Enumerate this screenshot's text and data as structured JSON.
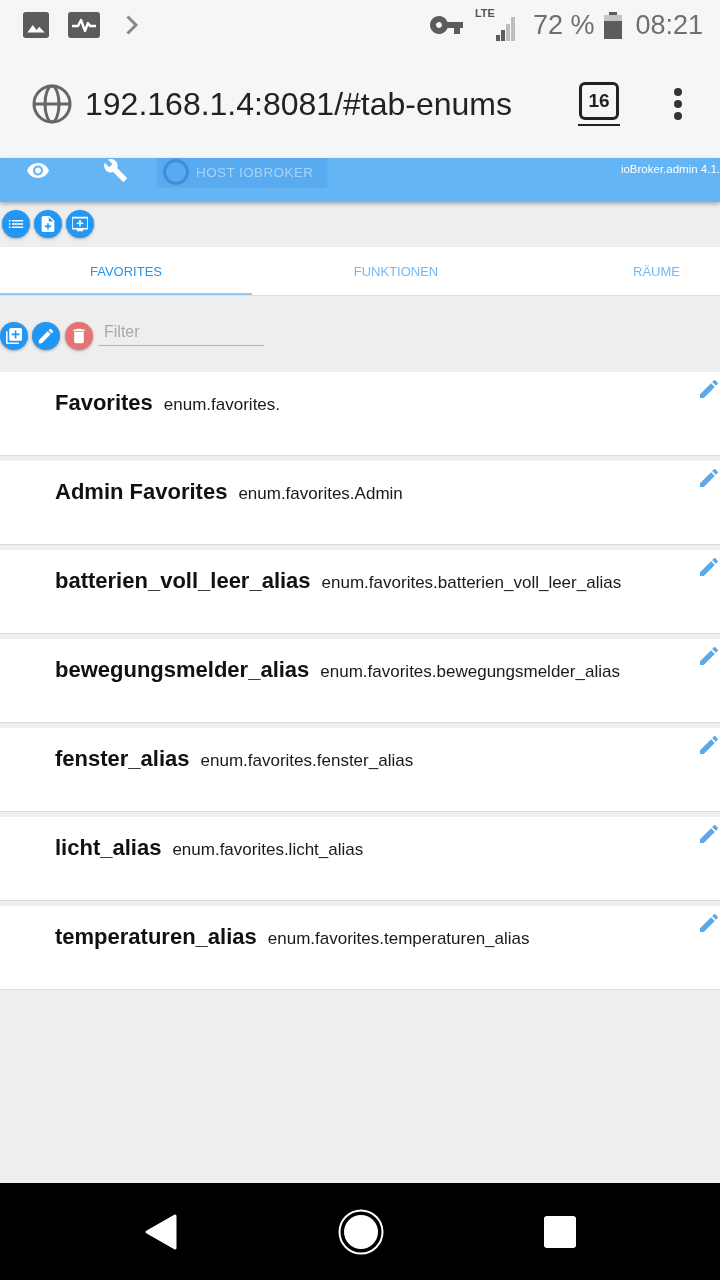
{
  "status_bar": {
    "network": "LTE",
    "battery": "72 %",
    "time": "08:21"
  },
  "browser": {
    "url": "192.168.1.4:8081/#tab-enums",
    "tab_count": "16"
  },
  "app_bar": {
    "host": "HOST IOBROKER",
    "version": "ioBroker.admin 4.1."
  },
  "tabs": [
    {
      "label": "FAVORITES",
      "selected": true
    },
    {
      "label": "FUNKTIONEN",
      "selected": false
    },
    {
      "label": "RÄUME",
      "selected": false
    }
  ],
  "filter": {
    "placeholder": "Filter"
  },
  "enums": [
    {
      "name": "Favorites",
      "id": "enum.favorites."
    },
    {
      "name": "Admin Favorites",
      "id": "enum.favorites.Admin"
    },
    {
      "name": "batterien_voll_leer_alias",
      "id": "enum.favorites.batterien_voll_leer_alias"
    },
    {
      "name": "bewegungsmelder_alias",
      "id": "enum.favorites.bewegungsmelder_alias"
    },
    {
      "name": "fenster_alias",
      "id": "enum.favorites.fenster_alias"
    },
    {
      "name": "licht_alias",
      "id": "enum.favorites.licht_alias"
    },
    {
      "name": "temperaturen_alias",
      "id": "enum.favorites.temperaturen_alias"
    }
  ]
}
